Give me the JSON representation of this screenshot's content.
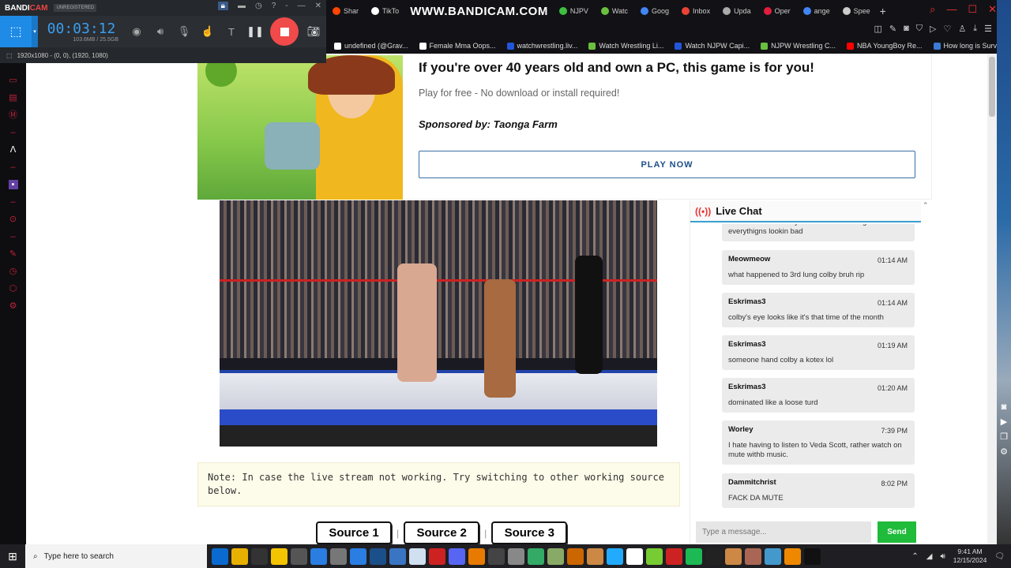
{
  "browser": {
    "watermark": "WWW.BANDICAM.COM",
    "tabs": [
      {
        "label": "Shar",
        "color": "#ff4500"
      },
      {
        "label": "TikTo",
        "color": "#ffffff"
      },
      {
        "label": "NJPV",
        "color": "#3fbf3f"
      },
      {
        "label": "Watc",
        "color": "#6bbf3f"
      },
      {
        "label": "Goog",
        "color": "#4285f4"
      },
      {
        "label": "Inbox",
        "color": "#ea4335"
      },
      {
        "label": "Upda",
        "color": "#aaaaaa"
      },
      {
        "label": "Oper",
        "color": "#e01e3c"
      },
      {
        "label": "ange",
        "color": "#4285f4"
      },
      {
        "label": "Spee",
        "color": "#cccccc"
      }
    ],
    "bookmarks": [
      {
        "label": "undefined (@Grav...",
        "color": "#ffffff"
      },
      {
        "label": "Female Mma Oops...",
        "color": "#ffffff"
      },
      {
        "label": "watchwrestling.liv...",
        "color": "#2255dd"
      },
      {
        "label": "Watch Wrestling Li...",
        "color": "#6bbf3f"
      },
      {
        "label": "Watch NJPW Capi...",
        "color": "#2255dd"
      },
      {
        "label": "NJPW Wrestling C...",
        "color": "#6bbf3f"
      },
      {
        "label": "NBA YoungBoy Re...",
        "color": "#ff0000"
      },
      {
        "label": "How long is Surviv...",
        "color": "#3a7bd5"
      }
    ]
  },
  "bandicam": {
    "logo_a": "BANDI",
    "logo_b": "CAM",
    "badge": "UNREGISTERED",
    "timer": "00:03:12",
    "size": "103.6MB / 25.5GB",
    "region": "1920x1080 - (0, 0), (1920, 1080)"
  },
  "ad": {
    "title": "If you're over 40 years old and own a PC, this game is for you!",
    "subtitle": "Play for free - No download or install required!",
    "sponsor": "Sponsored by: Taonga Farm",
    "button": "PLAY NOW"
  },
  "note": "Note: In case the live stream not working. Try switching to other working source below.",
  "sources": [
    "Source 1",
    "Source 2",
    "Source 3"
  ],
  "chat": {
    "title": "Live Chat",
    "messages": [
      {
        "user": "",
        "time": "",
        "text": "I woudint count colby out but his wrestling n everythigns lookin bad"
      },
      {
        "user": "Meowmeow",
        "time": "01:14 AM",
        "text": "what happened to 3rd lung colby bruh rip"
      },
      {
        "user": "Eskrimas3",
        "time": "01:14 AM",
        "text": "colby's eye looks like it's that time of the month"
      },
      {
        "user": "Eskrimas3",
        "time": "01:19 AM",
        "text": "someone hand colby a kotex lol"
      },
      {
        "user": "Eskrimas3",
        "time": "01:20 AM",
        "text": "dominated like a loose turd"
      },
      {
        "user": "Worley",
        "time": "7:39 PM",
        "text": "I hate having to listen to Veda Scott, rather watch on mute withb music."
      },
      {
        "user": "Dammitchrist",
        "time": "8:02 PM",
        "text": "FACK DA MUTE"
      }
    ],
    "placeholder": "Type a message...",
    "send": "Send"
  },
  "taskbar": {
    "search_placeholder": "Type here to search",
    "time": "9:41 AM",
    "date": "12/15/2024"
  }
}
